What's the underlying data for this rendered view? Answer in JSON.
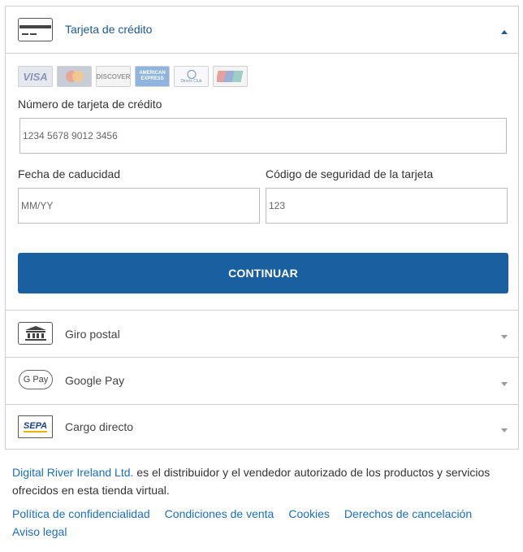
{
  "payment_methods": {
    "credit_card": {
      "label": "Tarjeta de crédito",
      "icon": "credit-card-icon",
      "expanded": true,
      "card_logos": [
        "VISA",
        "Mastercard",
        "DISCOVER",
        "AMERICAN EXPRESS",
        "Diners Club",
        "UnionPay"
      ],
      "card_number": {
        "label": "Número de tarjeta de crédito",
        "placeholder": "1234 5678 9012 3456"
      },
      "expiry": {
        "label": "Fecha de caducidad",
        "placeholder": "MM/YY"
      },
      "cvv": {
        "label": "Código de seguridad de la tarjeta",
        "placeholder": "123"
      },
      "continue_label": "CONTINUAR"
    },
    "bank_transfer": {
      "label": "Giro postal",
      "icon": "bank-icon"
    },
    "google_pay": {
      "label": "Google Pay",
      "icon": "google-pay-icon",
      "icon_text": "G Pay"
    },
    "sepa": {
      "label": "Cargo directo",
      "icon": "sepa-icon",
      "icon_text": "SEPA"
    }
  },
  "footer": {
    "company_link": "Digital River Ireland Ltd.",
    "company_text": " es el distribuidor y el vendedor autorizado de los productos y servicios ofrecidos en esta tienda virtual.",
    "links": [
      "Política de confidencialidad",
      "Condiciones de venta",
      "Cookies",
      "Derechos de cancelación",
      "Aviso legal"
    ]
  },
  "colors": {
    "accent": "#1a5fa0",
    "link": "#1a6fc0",
    "border": "#cfcfcf"
  }
}
